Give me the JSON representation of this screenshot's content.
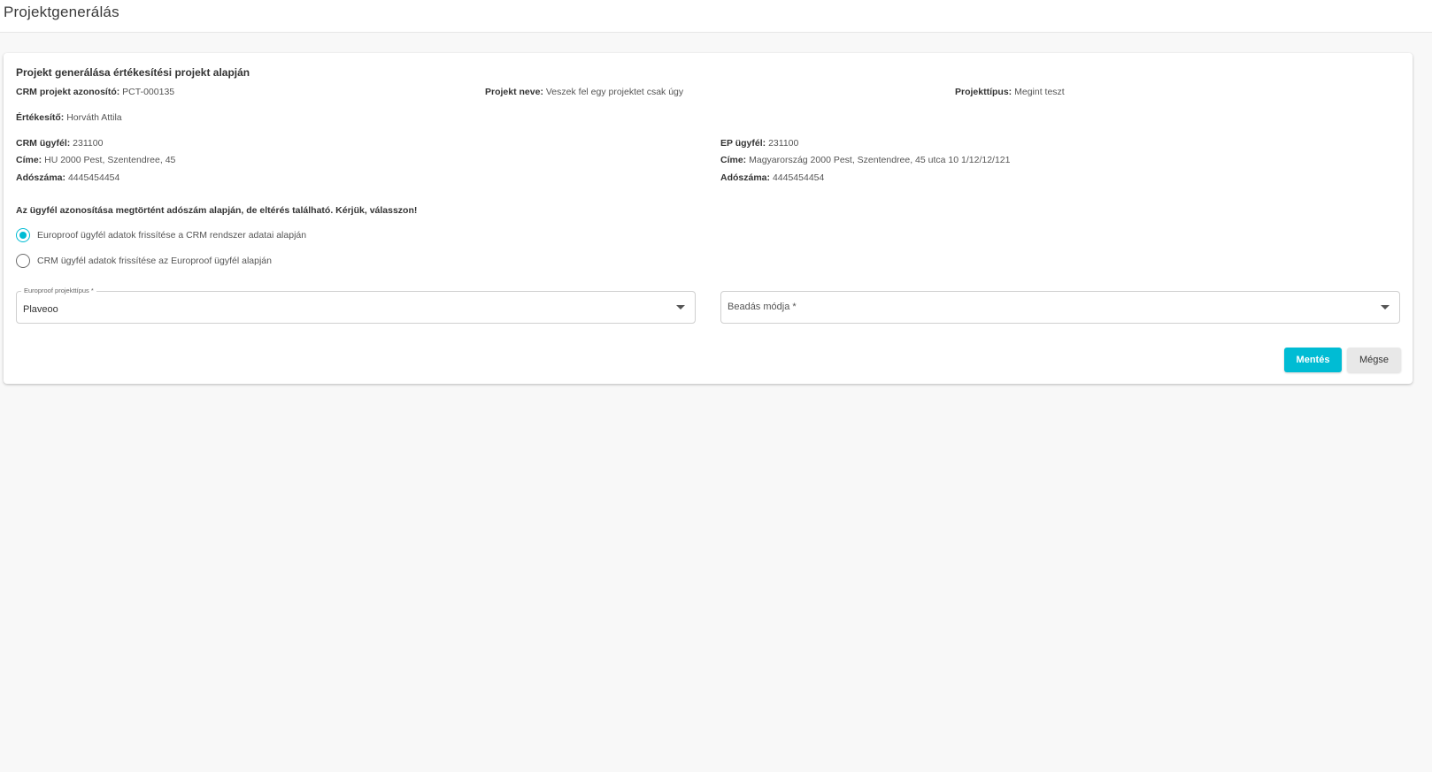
{
  "header": {
    "title": "Projektgenerálás"
  },
  "card": {
    "title": "Projekt generálása értékesítési projekt alapján",
    "crm_project_id": {
      "label": "CRM projekt azonosító:",
      "value": "PCT-000135"
    },
    "project_name": {
      "label": "Projekt neve:",
      "value": "Veszek fel egy projektet csak úgy"
    },
    "project_type": {
      "label": "Projekttípus:",
      "value": "Megint teszt"
    },
    "salesperson": {
      "label": "Értékesítő:",
      "value": "Horváth Attila"
    },
    "crm_customer": {
      "id": {
        "label": "CRM ügyfél:",
        "value": "231100"
      },
      "address": {
        "label": "Címe:",
        "value": "HU 2000 Pest, Szentendree, 45"
      },
      "tax_number": {
        "label": "Adószáma:",
        "value": "4445454454"
      }
    },
    "ep_customer": {
      "id": {
        "label": "EP ügyfél:",
        "value": "231100"
      },
      "address": {
        "label": "Címe:",
        "value": "Magyarország 2000 Pest, Szentendree, 45 utca 10 1/12/12/121"
      },
      "tax_number": {
        "label": "Adószáma:",
        "value": "4445454454"
      }
    },
    "notice": "Az ügyfél azonosítása megtörtént adószám alapján, de eltérés található. Kérjük, válasszon!",
    "options": [
      {
        "label": "Europroof ügyfél adatok frissítése a CRM rendszer adatai alapján",
        "checked": true
      },
      {
        "label": "CRM ügyfél adatok frissítése az Europroof ügyfél alapján",
        "checked": false
      }
    ],
    "ep_project_type_select": {
      "label": "Europroof projekttípus *",
      "value": "Plaveoo"
    },
    "submission_select": {
      "placeholder": "Beadás módja *"
    },
    "buttons": {
      "save": "Mentés",
      "cancel": "Mégse"
    }
  },
  "colors": {
    "accent": "#00bcd4",
    "cancel_bg": "#e8e8e8",
    "page_bg": "#f8f8f8"
  }
}
